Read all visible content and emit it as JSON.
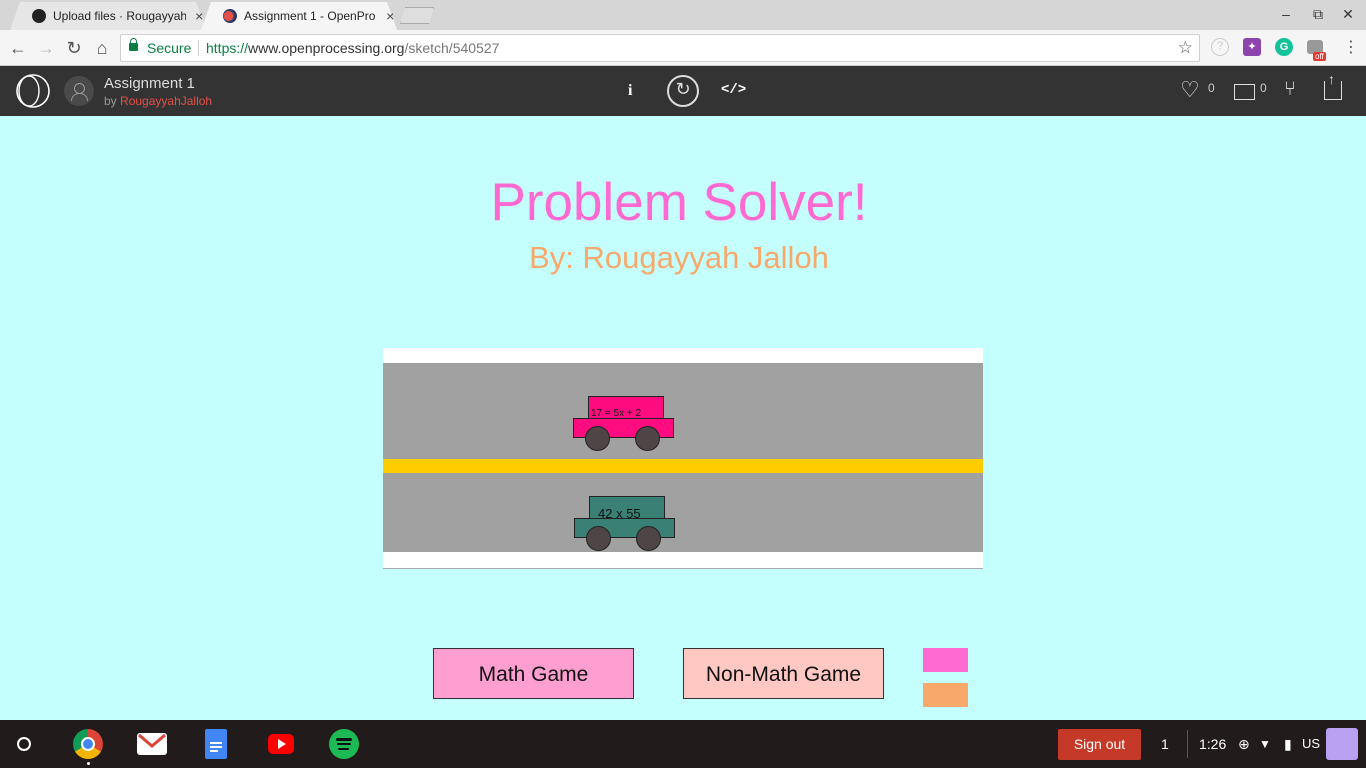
{
  "browser": {
    "tabs": [
      {
        "title": "Upload files · Rougayyah",
        "active": false
      },
      {
        "title": "Assignment 1 - OpenPro",
        "active": true
      }
    ],
    "tab_close": "×",
    "window_controls": {
      "minimize": "–",
      "restore": "⧉",
      "close": "✕"
    },
    "nav": {
      "back": "←",
      "forward": "→",
      "reload": "↻",
      "home": "⌂"
    },
    "secure_label": "Secure",
    "url": {
      "scheme": "https://",
      "host": "www.openprocessing.org",
      "path": "/sketch/540527"
    },
    "star": "☆",
    "extensions": [
      {
        "name": "help-circle-icon",
        "color": "#cccccc",
        "glyph": "?"
      },
      {
        "name": "extension-puzzle-icon",
        "color": "#8e44ad",
        "glyph": "✦"
      },
      {
        "name": "grammarly-icon",
        "color": "#15c39a",
        "glyph": "G"
      },
      {
        "name": "extension-off-icon",
        "color": "#999999",
        "glyph": ""
      }
    ],
    "ext_badge": "off",
    "menu": "⋮"
  },
  "openprocessing": {
    "title": "Assignment 1",
    "by_label": "by",
    "author": "RougayyahJalloh",
    "info": "i",
    "restart": "↻",
    "code": "</>",
    "likes": "0",
    "comments": "0",
    "heart": "♡",
    "fork": "⑂"
  },
  "sketch": {
    "title": "Problem Solver!",
    "subtitle": "By: Rougayyah Jalloh",
    "cars": [
      {
        "label": "17 = 5x + 2",
        "color": "#ff0d80",
        "font_size": "10px"
      },
      {
        "label": "42 x 55",
        "color": "#3a8075",
        "font_size": "13px"
      }
    ],
    "buttons": {
      "math": {
        "label": "Math Game",
        "color": "#ff9fd1"
      },
      "non_math": {
        "label": "Non-Math Game",
        "color": "#ffc8c3"
      }
    },
    "swatches": [
      "#ff69d2",
      "#f7a86a"
    ]
  },
  "shelf": {
    "apps": [
      {
        "name": "chrome-icon",
        "color": "#4285f4"
      },
      {
        "name": "gmail-icon",
        "color": "#ffffff"
      },
      {
        "name": "google-docs-icon",
        "color": "#4285f4"
      },
      {
        "name": "youtube-icon",
        "color": "#ff0000"
      },
      {
        "name": "spotify-icon",
        "color": "#1db954"
      }
    ],
    "sign_out": "Sign out",
    "notifications": "1",
    "time": "1:26",
    "sync_icon": "⊕",
    "wifi_icon": "▼",
    "battery_icon": "▮",
    "ime": "US"
  }
}
